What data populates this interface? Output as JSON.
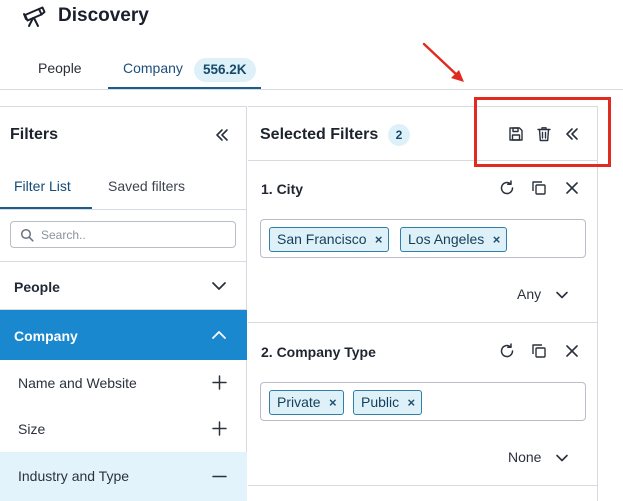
{
  "app": {
    "title": "Discovery"
  },
  "tabs": {
    "people": "People",
    "company": "Company",
    "company_count": "556.2K"
  },
  "filters_panel": {
    "title": "Filters",
    "subtabs": {
      "filter_list": "Filter List",
      "saved_filters": "Saved filters"
    },
    "search": {
      "placeholder": "Search..",
      "value": ""
    },
    "sections": {
      "people": "People",
      "company": "Company"
    },
    "company_items": [
      {
        "label": "Name and Website",
        "state": "collapsed"
      },
      {
        "label": "Size",
        "state": "collapsed"
      },
      {
        "label": "Industry and Type",
        "state": "expanded"
      }
    ]
  },
  "selected_panel": {
    "title": "Selected Filters",
    "count": "2",
    "filters": [
      {
        "heading": "1. City",
        "values": [
          "San Francisco",
          "Los Angeles"
        ],
        "match": "Any"
      },
      {
        "heading": "2. Company Type",
        "values": [
          "Private",
          "Public"
        ],
        "match": "None"
      }
    ]
  },
  "colors": {
    "accent": "#1a88cf",
    "highlight": "#e12b20",
    "chip_bg": "#dff1f8",
    "subitem_active_bg": "#e3f3fc"
  },
  "icons": {
    "brand": "telescope-icon",
    "collapse": "double-chevron-left-icon",
    "search": "search-icon",
    "save": "save-icon",
    "delete": "trash-icon",
    "refresh": "refresh-icon",
    "copy": "copy-icon",
    "close": "close-icon"
  }
}
